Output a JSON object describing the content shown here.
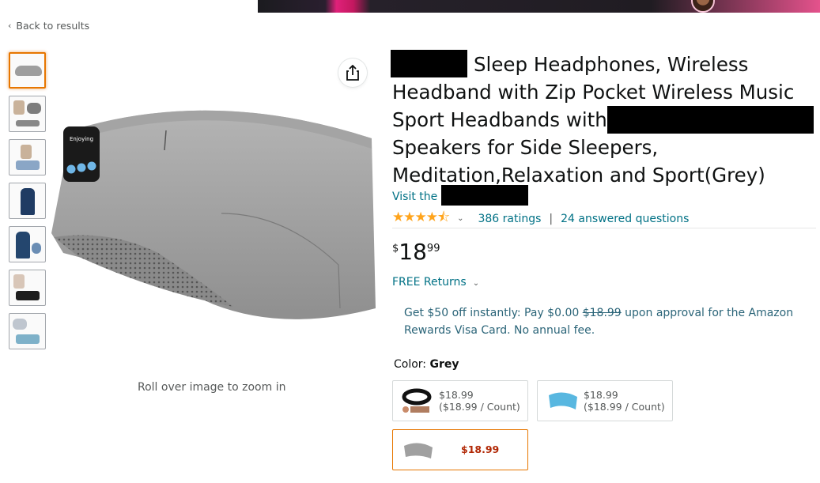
{
  "nav": {
    "back_label": "Back to results"
  },
  "product": {
    "title_part1": "Sleep Headphones, Wireless",
    "title_part2": "Headband with Zip Pocket Wireless Music",
    "title_part3": "Sport Headbands with",
    "title_part4": "Speakers for Side Sleepers,",
    "title_part5": "Meditation,Relaxation and Sport(Grey)",
    "visit_label": "Visit the",
    "star_glyphs": "★★★★⯪",
    "rating_count": "386 ratings",
    "separator": "|",
    "answered": "24 answered questions",
    "price_symbol": "$",
    "price_whole": "18",
    "price_fraction": "99",
    "returns_label": "FREE Returns",
    "promo_text_1": "Get $50 off instantly: Pay $0.00",
    "promo_strike": "$18.99",
    "promo_text_2": "upon approval for the Amazon Rewards Visa Card. No annual fee.",
    "color_label": "Color:",
    "color_value": "Grey",
    "zoom_hint": "Roll over image to zoom in"
  },
  "swatches": [
    {
      "price": "$18.99",
      "unit": "($18.99 / Count)"
    },
    {
      "price": "$18.99",
      "unit": "($18.99 / Count)"
    },
    {
      "price": "$18.99"
    }
  ],
  "colors": {
    "link": "#007185",
    "star": "#ffa41c",
    "price_red": "#b12704",
    "selected_border": "#e77600"
  }
}
